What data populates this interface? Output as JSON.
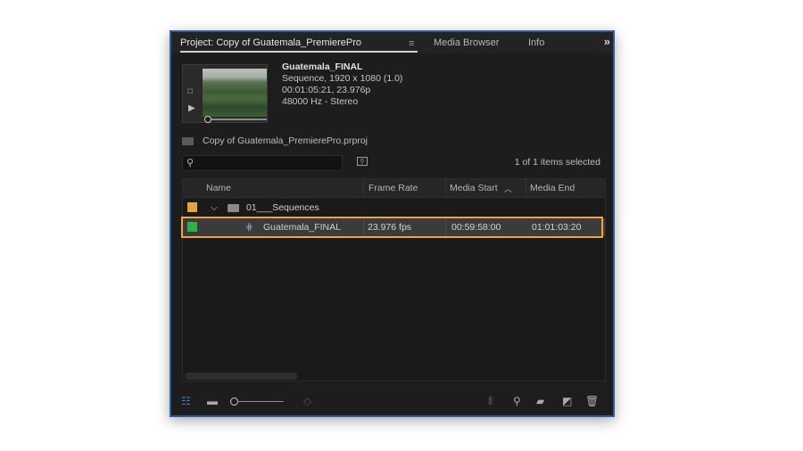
{
  "tabs": {
    "project": "Project: Copy of Guatemala_PremierePro",
    "media_browser": "Media Browser",
    "info": "Info",
    "overflow": "»"
  },
  "preview": {
    "clip_name": "Guatemala_FINAL",
    "line1": "Sequence, 1920 x 1080 (1.0)",
    "line2": "00:01:05:21, 23.976p",
    "line3": "48000 Hz - Stereo"
  },
  "project_file": "Copy of Guatemala_PremierePro.prproj",
  "search": {
    "placeholder": ""
  },
  "selection_count": "1 of  1 items selected",
  "columns": {
    "name": "Name",
    "frame_rate": "Frame Rate",
    "media_start": "Media Start",
    "media_end": "Media End"
  },
  "rows": [
    {
      "name": "01___Sequences",
      "label_color": "#e8a33c",
      "frame_rate": "",
      "media_start": "",
      "media_end": ""
    },
    {
      "name": "Guatemala_FINAL",
      "label_color": "#2fb04a",
      "frame_rate": "23.976 fps",
      "media_start": "00:59:58:00",
      "media_end": "01:01:03:20"
    }
  ],
  "colors": {
    "accent_blue": "#2f5d9a",
    "highlight_orange": "#f2a33a"
  }
}
